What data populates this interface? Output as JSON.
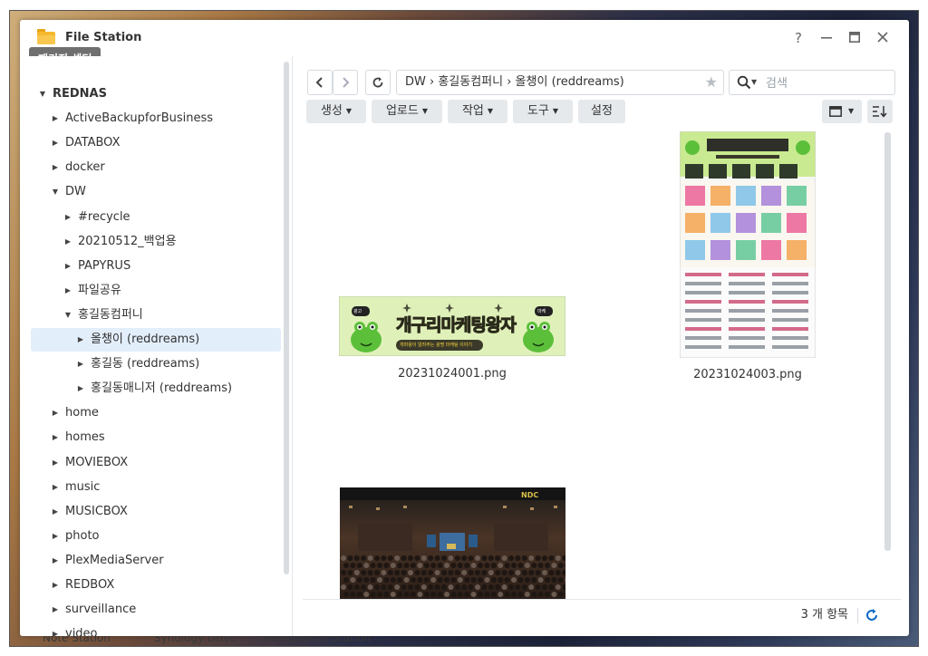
{
  "window": {
    "title": "File Station",
    "tooltip": "패키지 센터"
  },
  "taskbar": [
    "Note Station",
    "Synology Drive",
    "Surveillance Station"
  ],
  "sidebar": {
    "items": [
      {
        "label": "REDNAS",
        "level": 0,
        "expanded": true,
        "bold": true
      },
      {
        "label": "ActiveBackupforBusiness",
        "level": 1
      },
      {
        "label": "DATABOX",
        "level": 1
      },
      {
        "label": "docker",
        "level": 1
      },
      {
        "label": "DW",
        "level": 1,
        "expanded": true
      },
      {
        "label": "#recycle",
        "level": 2
      },
      {
        "label": "20210512_백업용",
        "level": 2
      },
      {
        "label": "PAPYRUS",
        "level": 2
      },
      {
        "label": "파일공유",
        "level": 2
      },
      {
        "label": "홍길동컴퍼니",
        "level": 2,
        "expanded": true
      },
      {
        "label": "올챙이 (reddreams)",
        "level": 3,
        "selected": true
      },
      {
        "label": "홍길동 (reddreams)",
        "level": 3
      },
      {
        "label": "홍길동매니저 (reddreams)",
        "level": 3
      },
      {
        "label": "home",
        "level": 1
      },
      {
        "label": "homes",
        "level": 1
      },
      {
        "label": "MOVIEBOX",
        "level": 1
      },
      {
        "label": "music",
        "level": 1
      },
      {
        "label": "MUSICBOX",
        "level": 1
      },
      {
        "label": "photo",
        "level": 1
      },
      {
        "label": "PlexMediaServer",
        "level": 1
      },
      {
        "label": "REDBOX",
        "level": 1
      },
      {
        "label": "surveillance",
        "level": 1
      },
      {
        "label": "video",
        "level": 1
      }
    ]
  },
  "path": "DW › 홍길동컴퍼니 › 올챙이 (reddreams)",
  "search": {
    "placeholder": "검색"
  },
  "actions": [
    {
      "label": "생성",
      "dropdown": true
    },
    {
      "label": "업로드",
      "dropdown": true
    },
    {
      "label": "작업",
      "dropdown": true
    },
    {
      "label": "도구",
      "dropdown": true
    },
    {
      "label": "설정",
      "dropdown": false
    }
  ],
  "files": [
    {
      "name": "20231024001.png"
    },
    {
      "name": "20231024003.png"
    },
    {
      "name": ""
    }
  ],
  "thumb_text": {
    "banner_title": "개구리마케팅왕자",
    "banner_sub": "개마왕이 알려주는 광명 마케팅 이야기",
    "badge_left": "광고",
    "badge_right": "마케",
    "video_logo": "NDC"
  },
  "status": {
    "count": "3 개 항목"
  },
  "colors": {
    "accent": "#0e6ac7",
    "selection": "#e3eefb",
    "button_bg": "#e6e9ec"
  }
}
